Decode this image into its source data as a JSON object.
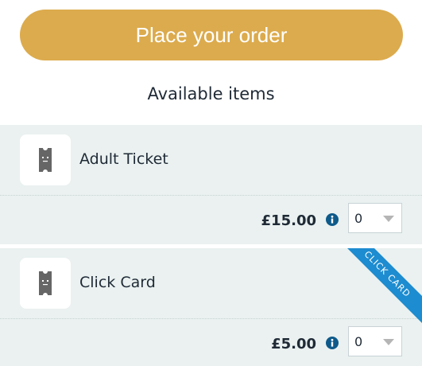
{
  "order_button": {
    "label": "Place your order"
  },
  "section": {
    "title": "Available items"
  },
  "items": [
    {
      "name": "Adult Ticket",
      "price": "£15.00",
      "quantity": "0",
      "ribbon": ""
    },
    {
      "name": "Click Card",
      "price": "£5.00",
      "quantity": "0",
      "ribbon": "CLICK CARD"
    }
  ],
  "colors": {
    "accent": "#dcab4d",
    "card_background": "#eaf1f0",
    "ribbon": "#1d8cd0",
    "info_icon": "#0e5a8a"
  },
  "icons": {
    "item_thumbnail": "ticket-icon",
    "info": "info-icon",
    "dropdown": "chevron-down-icon"
  }
}
